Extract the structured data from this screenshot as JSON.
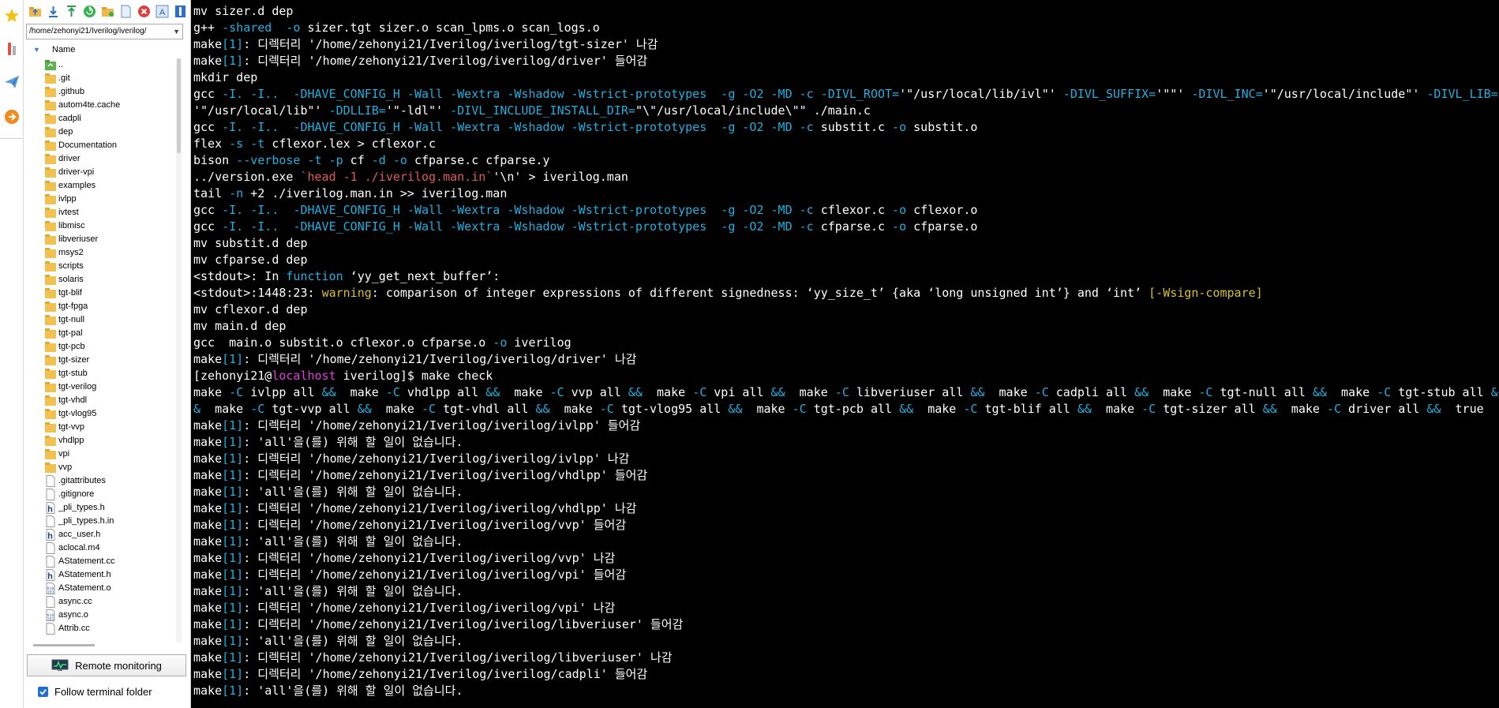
{
  "toolstrip": {
    "buttons": [
      {
        "icon": "star-icon",
        "color": "#f2c316"
      },
      {
        "icon": "tools-icon",
        "color": "#d9534f"
      },
      {
        "icon": "paper-plane-icon",
        "color": "#5b9bd5"
      },
      {
        "icon": "xfer-icon",
        "color": "#f28a1c"
      }
    ]
  },
  "file_browser": {
    "toolbar_icons": [
      "folder-up-icon",
      "download-icon",
      "upload-icon",
      "refresh-icon",
      "new-folder-icon",
      "new-file-icon",
      "delete-icon",
      "rename-icon",
      "settings-icon"
    ],
    "path": "/home/zehonyi21/Iverilog/iverilog/",
    "column_header": "Name",
    "items": [
      {
        "name": "..",
        "kind": "parent"
      },
      {
        "name": ".git",
        "kind": "folder"
      },
      {
        "name": ".github",
        "kind": "folder"
      },
      {
        "name": "autom4te.cache",
        "kind": "folder"
      },
      {
        "name": "cadpli",
        "kind": "folder"
      },
      {
        "name": "dep",
        "kind": "folder"
      },
      {
        "name": "Documentation",
        "kind": "folder"
      },
      {
        "name": "driver",
        "kind": "folder"
      },
      {
        "name": "driver-vpi",
        "kind": "folder"
      },
      {
        "name": "examples",
        "kind": "folder"
      },
      {
        "name": "ivlpp",
        "kind": "folder"
      },
      {
        "name": "ivtest",
        "kind": "folder"
      },
      {
        "name": "libmisc",
        "kind": "folder"
      },
      {
        "name": "libveriuser",
        "kind": "folder"
      },
      {
        "name": "msys2",
        "kind": "folder"
      },
      {
        "name": "scripts",
        "kind": "folder"
      },
      {
        "name": "solaris",
        "kind": "folder"
      },
      {
        "name": "tgt-blif",
        "kind": "folder"
      },
      {
        "name": "tgt-fpga",
        "kind": "folder"
      },
      {
        "name": "tgt-null",
        "kind": "folder"
      },
      {
        "name": "tgt-pal",
        "kind": "folder"
      },
      {
        "name": "tgt-pcb",
        "kind": "folder"
      },
      {
        "name": "tgt-sizer",
        "kind": "folder"
      },
      {
        "name": "tgt-stub",
        "kind": "folder"
      },
      {
        "name": "tgt-verilog",
        "kind": "folder"
      },
      {
        "name": "tgt-vhdl",
        "kind": "folder"
      },
      {
        "name": "tgt-vlog95",
        "kind": "folder"
      },
      {
        "name": "tgt-vvp",
        "kind": "folder"
      },
      {
        "name": "vhdlpp",
        "kind": "folder"
      },
      {
        "name": "vpi",
        "kind": "folder"
      },
      {
        "name": "vvp",
        "kind": "folder"
      },
      {
        "name": ".gitattributes",
        "kind": "file"
      },
      {
        "name": ".gitignore",
        "kind": "file"
      },
      {
        "name": "_pli_types.h",
        "kind": "header"
      },
      {
        "name": "_pli_types.h.in",
        "kind": "file"
      },
      {
        "name": "acc_user.h",
        "kind": "header"
      },
      {
        "name": "aclocal.m4",
        "kind": "file"
      },
      {
        "name": "AStatement.cc",
        "kind": "file"
      },
      {
        "name": "AStatement.h",
        "kind": "header"
      },
      {
        "name": "AStatement.o",
        "kind": "binary"
      },
      {
        "name": "async.cc",
        "kind": "file"
      },
      {
        "name": "async.o",
        "kind": "binary"
      },
      {
        "name": "Attrib.cc",
        "kind": "file"
      }
    ],
    "remote_monitoring_label": "Remote monitoring",
    "follow_terminal_label": "Follow terminal folder",
    "follow_terminal_checked": true
  },
  "terminal": {
    "colors": {
      "background": "#000000",
      "text": "#ffffff",
      "cyan": "#1fb0e0",
      "yellow": "#d7c02b",
      "magenta": "#e33ce3"
    },
    "lines": [
      [
        [
          "w",
          "mv sizer.d dep"
        ]
      ],
      [
        [
          "w",
          "g++ "
        ],
        [
          "c",
          "-shared"
        ],
        [
          "w",
          "  "
        ],
        [
          "c",
          "-o"
        ],
        [
          "w",
          " sizer.tgt sizer.o scan_lpms.o scan_logs.o"
        ]
      ],
      [
        [
          "w",
          "make"
        ],
        [
          "c",
          "[1]"
        ],
        [
          "w",
          ": 디렉터리 '/home/zehonyi21/Iverilog/iverilog/tgt-sizer' 나감"
        ]
      ],
      [
        [
          "w",
          "make"
        ],
        [
          "c",
          "[1]"
        ],
        [
          "w",
          ": 디렉터리 '/home/zehonyi21/Iverilog/iverilog/driver' 들어감"
        ]
      ],
      [
        [
          "w",
          "mkdir dep"
        ]
      ],
      [
        [
          "w",
          "gcc "
        ],
        [
          "c",
          "-I."
        ],
        [
          "w",
          " "
        ],
        [
          "c",
          "-I.."
        ],
        [
          "w",
          "  "
        ],
        [
          "c",
          "-DHAVE_CONFIG_H -Wall -Wextra -Wshadow -Wstrict-prototypes"
        ],
        [
          "w",
          "  "
        ],
        [
          "c",
          "-g -O2 -MD -c -DIVL_ROOT="
        ],
        [
          "w",
          "'\"/usr/local/lib/ivl\"' "
        ],
        [
          "c",
          "-DIVL_SUFFIX="
        ],
        [
          "w",
          "'\"\"' "
        ],
        [
          "c",
          "-DIVL_INC="
        ],
        [
          "w",
          "'\"/usr/local/include\"' "
        ],
        [
          "c",
          "-DIVL_LIB="
        ]
      ],
      [
        [
          "w",
          "'\"/usr/local/lib\"' "
        ],
        [
          "c",
          "-DDLLIB="
        ],
        [
          "w",
          "'\"-ldl\"' "
        ],
        [
          "c",
          "-DIVL_INCLUDE_INSTALL_DIR="
        ],
        [
          "w",
          "\"\\\"/usr/local/include\\\"\" ./main.c"
        ]
      ],
      [
        [
          "w",
          "gcc "
        ],
        [
          "c",
          "-I."
        ],
        [
          "w",
          " "
        ],
        [
          "c",
          "-I.."
        ],
        [
          "w",
          "  "
        ],
        [
          "c",
          "-DHAVE_CONFIG_H -Wall -Wextra -Wshadow -Wstrict-prototypes"
        ],
        [
          "w",
          "  "
        ],
        [
          "c",
          "-g -O2 -MD -c"
        ],
        [
          "w",
          " substit.c "
        ],
        [
          "c",
          "-o"
        ],
        [
          "w",
          " substit.o"
        ]
      ],
      [
        [
          "w",
          "flex "
        ],
        [
          "c",
          "-s -t"
        ],
        [
          "w",
          " cflexor.lex > cflexor.c"
        ]
      ],
      [
        [
          "w",
          "bison "
        ],
        [
          "c",
          "--verbose -t -p"
        ],
        [
          "w",
          " cf "
        ],
        [
          "c",
          "-d -o"
        ],
        [
          "w",
          " cfparse.c cfparse.y"
        ]
      ],
      [
        [
          "w",
          "../version.exe "
        ],
        [
          "r",
          "`head -1 ./iverilog.man.in`"
        ],
        [
          "w",
          "'\\n' > iverilog.man"
        ]
      ],
      [
        [
          "w",
          "tail "
        ],
        [
          "c",
          "-n"
        ],
        [
          "w",
          " +2 ./iverilog.man.in >> iverilog.man"
        ]
      ],
      [
        [
          "w",
          "gcc "
        ],
        [
          "c",
          "-I."
        ],
        [
          "w",
          " "
        ],
        [
          "c",
          "-I.."
        ],
        [
          "w",
          "  "
        ],
        [
          "c",
          "-DHAVE_CONFIG_H -Wall -Wextra -Wshadow -Wstrict-prototypes"
        ],
        [
          "w",
          "  "
        ],
        [
          "c",
          "-g -O2 -MD -c"
        ],
        [
          "w",
          " cflexor.c "
        ],
        [
          "c",
          "-o"
        ],
        [
          "w",
          " cflexor.o"
        ]
      ],
      [
        [
          "w",
          "gcc "
        ],
        [
          "c",
          "-I."
        ],
        [
          "w",
          " "
        ],
        [
          "c",
          "-I.."
        ],
        [
          "w",
          "  "
        ],
        [
          "c",
          "-DHAVE_CONFIG_H -Wall -Wextra -Wshadow -Wstrict-prototypes"
        ],
        [
          "w",
          "  "
        ],
        [
          "c",
          "-g -O2 -MD -c"
        ],
        [
          "w",
          " cfparse.c "
        ],
        [
          "c",
          "-o"
        ],
        [
          "w",
          " cfparse.o"
        ]
      ],
      [
        [
          "w",
          "mv substit.d dep"
        ]
      ],
      [
        [
          "w",
          "mv cfparse.d dep"
        ]
      ],
      [
        [
          "w",
          "<stdout>: In "
        ],
        [
          "c",
          "function"
        ],
        [
          "w",
          " ‘yy_get_next_buffer’:"
        ]
      ],
      [
        [
          "w",
          "<stdout>:1448:23: "
        ],
        [
          "y",
          "warning"
        ],
        [
          "w",
          ": comparison of integer expressions of different signedness: ‘yy_size_t’ {aka ‘long unsigned int’} and ‘int’ "
        ],
        [
          "y",
          "[-Wsign-compare]"
        ]
      ],
      [
        [
          "w",
          "mv cflexor.d dep"
        ]
      ],
      [
        [
          "w",
          "mv main.d dep"
        ]
      ],
      [
        [
          "w",
          "gcc  main.o substit.o cflexor.o cfparse.o "
        ],
        [
          "c",
          "-o"
        ],
        [
          "w",
          " iverilog"
        ]
      ],
      [
        [
          "w",
          "make"
        ],
        [
          "c",
          "[1]"
        ],
        [
          "w",
          ": 디렉터리 '/home/zehonyi21/Iverilog/iverilog/driver' 나감"
        ]
      ],
      [
        [
          "w",
          "[zehonyi21@"
        ],
        [
          "m",
          "localhost"
        ],
        [
          "w",
          " iverilog]$ make check"
        ]
      ],
      [
        [
          "w",
          "make "
        ],
        [
          "c",
          "-C"
        ],
        [
          "w",
          " ivlpp all "
        ],
        [
          "c",
          "&&"
        ],
        [
          "w",
          "  make "
        ],
        [
          "c",
          "-C"
        ],
        [
          "w",
          " vhdlpp all "
        ],
        [
          "c",
          "&&"
        ],
        [
          "w",
          "  make "
        ],
        [
          "c",
          "-C"
        ],
        [
          "w",
          " vvp all "
        ],
        [
          "c",
          "&&"
        ],
        [
          "w",
          "  make "
        ],
        [
          "c",
          "-C"
        ],
        [
          "w",
          " vpi all "
        ],
        [
          "c",
          "&&"
        ],
        [
          "w",
          "  make "
        ],
        [
          "c",
          "-C"
        ],
        [
          "w",
          " libveriuser all "
        ],
        [
          "c",
          "&&"
        ],
        [
          "w",
          "  make "
        ],
        [
          "c",
          "-C"
        ],
        [
          "w",
          " cadpli all "
        ],
        [
          "c",
          "&&"
        ],
        [
          "w",
          "  make "
        ],
        [
          "c",
          "-C"
        ],
        [
          "w",
          " tgt-null all "
        ],
        [
          "c",
          "&&"
        ],
        [
          "w",
          "  make "
        ],
        [
          "c",
          "-C"
        ],
        [
          "w",
          " tgt-stub all "
        ],
        [
          "c",
          "&"
        ]
      ],
      [
        [
          "c",
          "&"
        ],
        [
          "w",
          "  make "
        ],
        [
          "c",
          "-C"
        ],
        [
          "w",
          " tgt-vvp all "
        ],
        [
          "c",
          "&&"
        ],
        [
          "w",
          "  make "
        ],
        [
          "c",
          "-C"
        ],
        [
          "w",
          " tgt-vhdl all "
        ],
        [
          "c",
          "&&"
        ],
        [
          "w",
          "  make "
        ],
        [
          "c",
          "-C"
        ],
        [
          "w",
          " tgt-vlog95 all "
        ],
        [
          "c",
          "&&"
        ],
        [
          "w",
          "  make "
        ],
        [
          "c",
          "-C"
        ],
        [
          "w",
          " tgt-pcb all "
        ],
        [
          "c",
          "&&"
        ],
        [
          "w",
          "  make "
        ],
        [
          "c",
          "-C"
        ],
        [
          "w",
          " tgt-blif all "
        ],
        [
          "c",
          "&&"
        ],
        [
          "w",
          "  make "
        ],
        [
          "c",
          "-C"
        ],
        [
          "w",
          " tgt-sizer all "
        ],
        [
          "c",
          "&&"
        ],
        [
          "w",
          "  make "
        ],
        [
          "c",
          "-C"
        ],
        [
          "w",
          " driver all "
        ],
        [
          "c",
          "&&"
        ],
        [
          "w",
          "  true"
        ]
      ],
      [
        [
          "w",
          "make"
        ],
        [
          "c",
          "[1]"
        ],
        [
          "w",
          ": 디렉터리 '/home/zehonyi21/Iverilog/iverilog/ivlpp' 들어감"
        ]
      ],
      [
        [
          "w",
          "make"
        ],
        [
          "c",
          "[1]"
        ],
        [
          "w",
          ": 'all'을(를) 위해 할 일이 없습니다."
        ]
      ],
      [
        [
          "w",
          "make"
        ],
        [
          "c",
          "[1]"
        ],
        [
          "w",
          ": 디렉터리 '/home/zehonyi21/Iverilog/iverilog/ivlpp' 나감"
        ]
      ],
      [
        [
          "w",
          "make"
        ],
        [
          "c",
          "[1]"
        ],
        [
          "w",
          ": 디렉터리 '/home/zehonyi21/Iverilog/iverilog/vhdlpp' 들어감"
        ]
      ],
      [
        [
          "w",
          "make"
        ],
        [
          "c",
          "[1]"
        ],
        [
          "w",
          ": 'all'을(를) 위해 할 일이 없습니다."
        ]
      ],
      [
        [
          "w",
          "make"
        ],
        [
          "c",
          "[1]"
        ],
        [
          "w",
          ": 디렉터리 '/home/zehonyi21/Iverilog/iverilog/vhdlpp' 나감"
        ]
      ],
      [
        [
          "w",
          "make"
        ],
        [
          "c",
          "[1]"
        ],
        [
          "w",
          ": 디렉터리 '/home/zehonyi21/Iverilog/iverilog/vvp' 들어감"
        ]
      ],
      [
        [
          "w",
          "make"
        ],
        [
          "c",
          "[1]"
        ],
        [
          "w",
          ": 'all'을(를) 위해 할 일이 없습니다."
        ]
      ],
      [
        [
          "w",
          "make"
        ],
        [
          "c",
          "[1]"
        ],
        [
          "w",
          ": 디렉터리 '/home/zehonyi21/Iverilog/iverilog/vvp' 나감"
        ]
      ],
      [
        [
          "w",
          "make"
        ],
        [
          "c",
          "[1]"
        ],
        [
          "w",
          ": 디렉터리 '/home/zehonyi21/Iverilog/iverilog/vpi' 들어감"
        ]
      ],
      [
        [
          "w",
          "make"
        ],
        [
          "c",
          "[1]"
        ],
        [
          "w",
          ": 'all'을(를) 위해 할 일이 없습니다."
        ]
      ],
      [
        [
          "w",
          "make"
        ],
        [
          "c",
          "[1]"
        ],
        [
          "w",
          ": 디렉터리 '/home/zehonyi21/Iverilog/iverilog/vpi' 나감"
        ]
      ],
      [
        [
          "w",
          "make"
        ],
        [
          "c",
          "[1]"
        ],
        [
          "w",
          ": 디렉터리 '/home/zehonyi21/Iverilog/iverilog/libveriuser' 들어감"
        ]
      ],
      [
        [
          "w",
          "make"
        ],
        [
          "c",
          "[1]"
        ],
        [
          "w",
          ": 'all'을(를) 위해 할 일이 없습니다."
        ]
      ],
      [
        [
          "w",
          "make"
        ],
        [
          "c",
          "[1]"
        ],
        [
          "w",
          ": 디렉터리 '/home/zehonyi21/Iverilog/iverilog/libveriuser' 나감"
        ]
      ],
      [
        [
          "w",
          "make"
        ],
        [
          "c",
          "[1]"
        ],
        [
          "w",
          ": 디렉터리 '/home/zehonyi21/Iverilog/iverilog/cadpli' 들어감"
        ]
      ],
      [
        [
          "w",
          "make"
        ],
        [
          "c",
          "[1]"
        ],
        [
          "w",
          ": 'all'을(를) 위해 할 일이 없습니다."
        ]
      ]
    ]
  }
}
